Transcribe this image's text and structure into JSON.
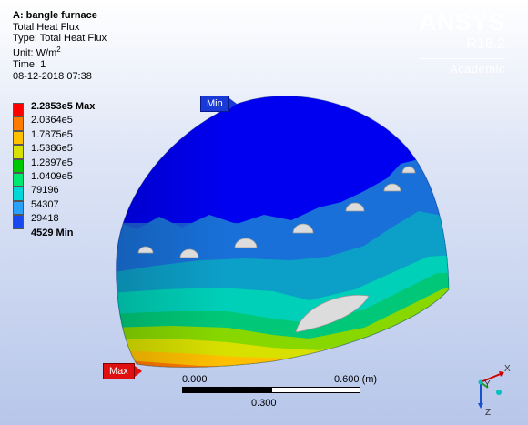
{
  "info": {
    "title": "A: bangle furnace",
    "result": "Total Heat Flux",
    "type": "Type: Total Heat Flux",
    "unit_prefix": "Unit: W/m",
    "unit_sup": "2",
    "time": "Time: 1",
    "date": "08-12-2018 07:38"
  },
  "brand": {
    "logo": "ANSYS",
    "version": "R18.2",
    "edition": "Academic"
  },
  "legend": {
    "labels": [
      "2.2853e5 Max",
      "2.0364e5",
      "1.7875e5",
      "1.5386e5",
      "1.2897e5",
      "1.0409e5",
      "79196",
      "54307",
      "29418",
      "4529 Min"
    ],
    "colors": [
      "#ff0000",
      "#ff7a00",
      "#ffc000",
      "#d8e000",
      "#00c800",
      "#00e870",
      "#00d8d8",
      "#2aa0ff",
      "#1848f0",
      "#0000ff"
    ]
  },
  "probes": {
    "min": "Min",
    "max": "Max"
  },
  "scale": {
    "start": "0.000",
    "end": "0.600 (m)",
    "mid": "0.300"
  },
  "triad": {
    "x": "X",
    "y": "Y",
    "z": "Z"
  }
}
